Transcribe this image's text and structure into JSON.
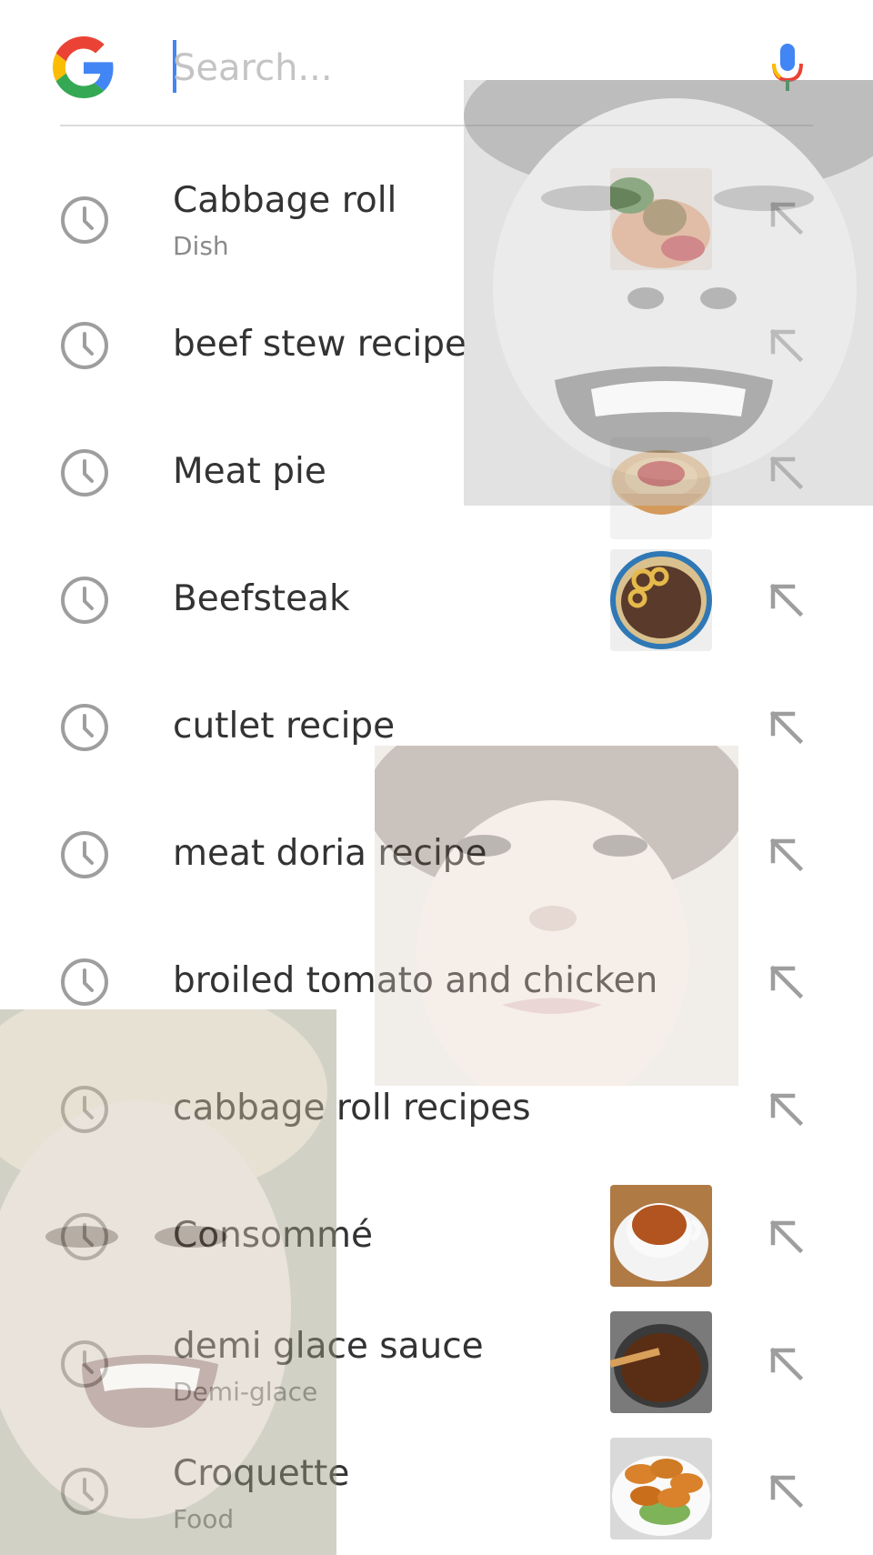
{
  "search": {
    "placeholder": "Search..."
  },
  "suggestions": [
    {
      "label": "Cabbage roll",
      "subtitle": "Dish",
      "thumbnail": "cabbage-roll-dish"
    },
    {
      "label": "beef stew recipe"
    },
    {
      "label": "Meat pie",
      "thumbnail": "meat-pie"
    },
    {
      "label": "Beefsteak",
      "thumbnail": "beefsteak-plate"
    },
    {
      "label": "cutlet recipe"
    },
    {
      "label": "meat doria recipe"
    },
    {
      "label": "broiled tomato and chicken"
    },
    {
      "label": "cabbage roll recipes"
    },
    {
      "label": "Consommé",
      "thumbnail": "consomme-cup"
    },
    {
      "label": "demi glace sauce",
      "subtitle": "Demi-glace",
      "thumbnail": "demi-glace-pot"
    },
    {
      "label": "Croquette",
      "subtitle": "Food",
      "thumbnail": "croquettes-plate"
    }
  ],
  "icons": {
    "history": "clock-icon",
    "fill_query": "arrow-up-left-icon",
    "voice": "microphone-icon",
    "brand": "google-g-logo"
  },
  "colors": {
    "google_blue": "#4285F4",
    "google_red": "#EA4335",
    "google_yellow": "#FBBC05",
    "google_green": "#34A853",
    "icon_gray": "#9e9e9e",
    "text_primary": "#333333",
    "text_secondary": "#8a8a8a"
  }
}
